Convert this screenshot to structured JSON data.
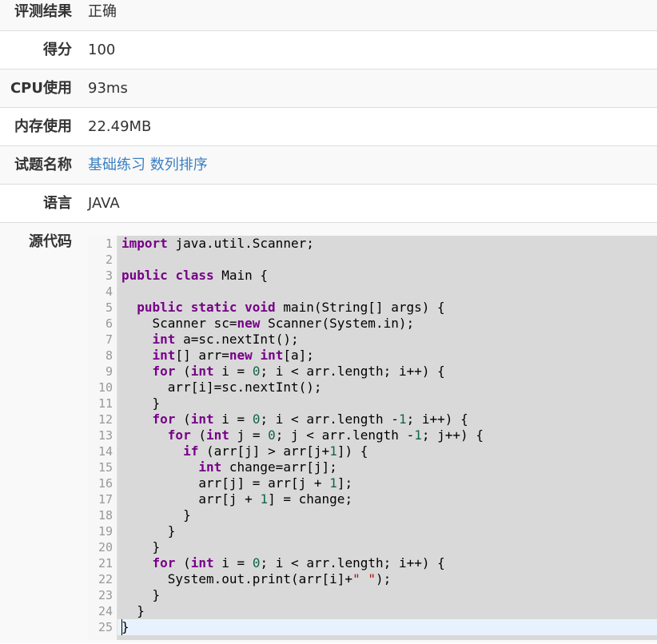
{
  "info": {
    "result_label": "评测结果",
    "result_value": "正确",
    "score_label": "得分",
    "score_value": "100",
    "cpu_label": "CPU使用",
    "cpu_value": "93ms",
    "mem_label": "内存使用",
    "mem_value": "22.49MB",
    "problem_label": "试题名称",
    "problem_value": "基础练习 数列排序",
    "lang_label": "语言",
    "lang_value": "JAVA",
    "code_label": "源代码"
  },
  "code": {
    "line_numbers": [
      "1",
      "2",
      "3",
      "4",
      "5",
      "6",
      "7",
      "8",
      "9",
      "10",
      "11",
      "12",
      "13",
      "14",
      "15",
      "16",
      "17",
      "18",
      "19",
      "20",
      "21",
      "22",
      "23",
      "24",
      "25"
    ],
    "lines": [
      "import java.util.Scanner;",
      "",
      "public class Main {",
      "",
      "  public static void main(String[] args) {",
      "    Scanner sc=new Scanner(System.in);",
      "    int a=sc.nextInt();",
      "    int[] arr=new int[a];",
      "    for (int i = 0; i < arr.length; i++) {",
      "      arr[i]=sc.nextInt();",
      "    }",
      "    for (int i = 0; i < arr.length -1; i++) {",
      "      for (int j = 0; j < arr.length -1; j++) {",
      "        if (arr[j] > arr[j+1]) {",
      "          int change=arr[j];",
      "          arr[j] = arr[j + 1];",
      "          arr[j + 1] = change;",
      "        }",
      "      }",
      "    }",
      "    for (int i = 0; i < arr.length; i++) {",
      "      System.out.print(arr[i]+\" \");",
      "    }",
      "  }",
      "}"
    ]
  },
  "colors": {
    "link": "#3a7fc1",
    "keyword": "#770088",
    "number": "#116644",
    "string": "#aa1111"
  }
}
